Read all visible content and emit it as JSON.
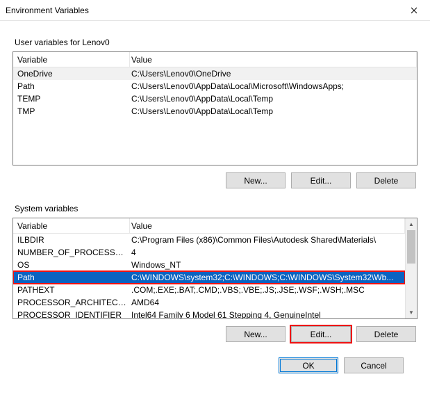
{
  "window": {
    "title": "Environment Variables"
  },
  "userSection": {
    "label": "User variables for Lenov0",
    "headers": {
      "name": "Variable",
      "value": "Value"
    },
    "rows": [
      {
        "name": "OneDrive",
        "value": "C:\\Users\\Lenov0\\OneDrive",
        "selected": true
      },
      {
        "name": "Path",
        "value": "C:\\Users\\Lenov0\\AppData\\Local\\Microsoft\\WindowsApps;"
      },
      {
        "name": "TEMP",
        "value": "C:\\Users\\Lenov0\\AppData\\Local\\Temp"
      },
      {
        "name": "TMP",
        "value": "C:\\Users\\Lenov0\\AppData\\Local\\Temp"
      }
    ],
    "buttons": {
      "new": "New...",
      "edit": "Edit...",
      "delete": "Delete"
    }
  },
  "sysSection": {
    "label": "System variables",
    "headers": {
      "name": "Variable",
      "value": "Value"
    },
    "rows": [
      {
        "name": "ILBDIR",
        "value": "C:\\Program Files (x86)\\Common Files\\Autodesk Shared\\Materials\\"
      },
      {
        "name": "NUMBER_OF_PROCESSORS",
        "value": "4"
      },
      {
        "name": "OS",
        "value": "Windows_NT"
      },
      {
        "name": "Path",
        "value": "C:\\WINDOWS\\system32;C:\\WINDOWS;C:\\WINDOWS\\System32\\Wb...",
        "selected": true
      },
      {
        "name": "PATHEXT",
        "value": ".COM;.EXE;.BAT;.CMD;.VBS;.VBE;.JS;.JSE;.WSF;.WSH;.MSC"
      },
      {
        "name": "PROCESSOR_ARCHITECTURE",
        "value": "AMD64"
      },
      {
        "name": "PROCESSOR_IDENTIFIER",
        "value": "Intel64 Family 6 Model 61 Stepping 4, GenuineIntel"
      }
    ],
    "buttons": {
      "new": "New...",
      "edit": "Edit...",
      "delete": "Delete"
    }
  },
  "footer": {
    "ok": "OK",
    "cancel": "Cancel"
  }
}
